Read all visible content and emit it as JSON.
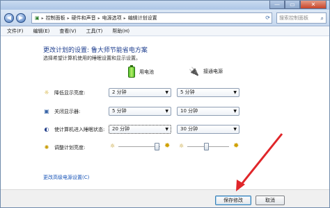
{
  "window": {
    "controls": {
      "minimize": "—",
      "maximize": "▭",
      "close": "✕"
    }
  },
  "address": {
    "crumbs": [
      "控制面板",
      "硬件和声音",
      "电源选项",
      "编辑计划设置"
    ],
    "search_placeholder": "搜索控制面板"
  },
  "menu": [
    "文件(F)",
    "编辑(E)",
    "查看(V)",
    "工具(T)",
    "帮助(H)"
  ],
  "main": {
    "heading": "更改计划的设置: 鲁大师节能省电方案",
    "subheading": "选择希望计算机使用的睡眠设置和显示设置。",
    "columns": {
      "battery": "用电池",
      "plugged": "接通电源"
    },
    "rows": [
      {
        "label": "降低显示亮度:",
        "battery": "2 分钟",
        "plugged": "5 分钟",
        "icon": "display-dim-icon"
      },
      {
        "label": "关闭显示器:",
        "battery": "5 分钟",
        "plugged": "10 分钟",
        "icon": "monitor-icon"
      },
      {
        "label": "使计算机进入睡眠状态:",
        "battery": "20 分钟",
        "plugged": "30 分钟",
        "icon": "sleep-moon-icon"
      }
    ],
    "brightness": {
      "label": "调整计划亮度:",
      "battery_level": 0.92,
      "plugged_level": 0.45
    },
    "advanced_link": "更改高级电源设置(C)"
  },
  "buttons": {
    "save": "保存修改",
    "cancel": "取消"
  },
  "colors": {
    "heading": "#1f3f8f",
    "link": "#1a56b8",
    "annotation_arrow": "#e0262a"
  }
}
